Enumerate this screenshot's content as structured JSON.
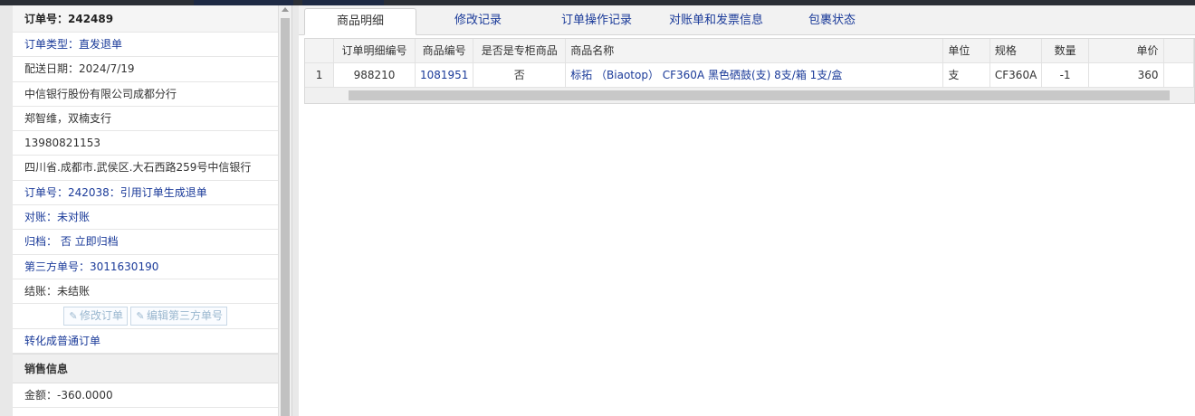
{
  "order": {
    "header": "订单号：242489",
    "fields": [
      {
        "text": "订单类型：直发退单",
        "style": "blue"
      },
      {
        "text": "配送日期：2024/7/19",
        "style": "plain"
      },
      {
        "text": "中信银行股份有限公司成都分行",
        "style": "plain"
      },
      {
        "text": "郑智维，双楠支行",
        "style": "plain"
      },
      {
        "text": "13980821153",
        "style": "plain"
      },
      {
        "text": "四川省.成都市.武侯区.大石西路259号中信银行",
        "style": "plain"
      },
      {
        "text": "订单号：242038：引用订单生成退单",
        "style": "blue"
      },
      {
        "text": "对账：未对账",
        "style": "blue"
      },
      {
        "text": "归档：  否 立即归档",
        "style": "blue"
      },
      {
        "text": "第三方单号：3011630190",
        "style": "blue"
      },
      {
        "text": "结账：未结账",
        "style": "plain"
      }
    ],
    "buttons": {
      "edit_order": "修改订单",
      "edit_third_party": "编辑第三方单号"
    },
    "convert_link": "转化成普通订单"
  },
  "sales": {
    "title": "销售信息",
    "amount": "金额：-360.0000"
  },
  "tabs": [
    {
      "label": "商品明细",
      "active": true
    },
    {
      "label": "修改记录",
      "active": false
    },
    {
      "label": "订单操作记录",
      "active": false
    },
    {
      "label": "对账单和发票信息",
      "active": false
    },
    {
      "label": "包裹状态",
      "active": false
    }
  ],
  "grid": {
    "columns": [
      "订单明细编号",
      "商品编号",
      "是否是专柜商品",
      "商品名称",
      "单位",
      "规格",
      "数量",
      "单价"
    ],
    "rows": [
      {
        "index": "1",
        "detail_id": "988210",
        "product_id": "1081951",
        "counter_item": "否",
        "name": "标拓 （Biaotop） CF360A 黑色硒鼓(支) 8支/箱 1支/盒",
        "unit": "支",
        "spec": "CF360A",
        "qty": "-1",
        "price": "360"
      }
    ]
  },
  "colors": {
    "link": "#1a3a99",
    "disabled_button": "#9ab7cf"
  },
  "icons": {
    "edit": "pencil-square-icon"
  }
}
